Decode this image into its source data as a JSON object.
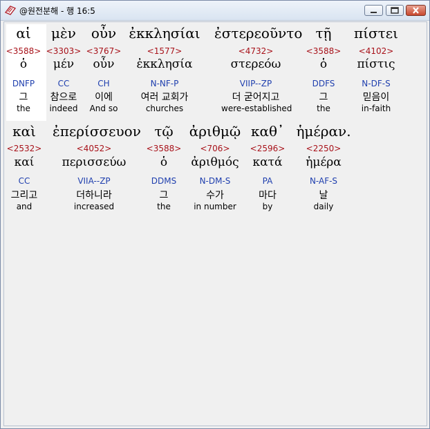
{
  "window": {
    "title": "@원전분해 - 행 16:5",
    "app_icon": "bible-book-icon",
    "buttons": [
      "minimize",
      "maximize",
      "close"
    ]
  },
  "verse": {
    "row1": [
      {
        "greek": "αἱ",
        "strong": "<3588>",
        "lemma": "ὁ",
        "parse": "DNFP",
        "korean": "그",
        "english": "the"
      },
      {
        "greek": "μὲν",
        "strong": "<3303>",
        "lemma": "μέν",
        "parse": "CC",
        "korean": "참으로",
        "english": "indeed"
      },
      {
        "greek": "οὖν",
        "strong": "<3767>",
        "lemma": "οὖν",
        "parse": "CH",
        "korean": "이에",
        "english": "And so"
      },
      {
        "greek": "ἐκκλησίαι",
        "strong": "<1577>",
        "lemma": "ἐκκλησία",
        "parse": "N-NF-P",
        "korean": "여러 교회가",
        "english": "churches"
      },
      {
        "greek": "ἐστερεοῦντο",
        "strong": "<4732>",
        "lemma": "στερεόω",
        "parse": "VIIP--ZP",
        "korean": "더 굳어지고",
        "english": "were-established"
      },
      {
        "greek": "τῇ",
        "strong": "<3588>",
        "lemma": "ὁ",
        "parse": "DDFS",
        "korean": "그",
        "english": "the"
      },
      {
        "greek": "πίστει",
        "strong": "<4102>",
        "lemma": "πίστις",
        "parse": "N-DF-S",
        "korean": "믿음이",
        "english": "in-faith"
      }
    ],
    "row2": [
      {
        "greek": "καὶ",
        "strong": "<2532>",
        "lemma": "καί",
        "parse": "CC",
        "korean": "그리고",
        "english": "and"
      },
      {
        "greek": "ἐπερίσσευον",
        "strong": "<4052>",
        "lemma": "περισσεύω",
        "parse": "VIIA--ZP",
        "korean": "더하니라",
        "english": "increased"
      },
      {
        "greek": "τῷ",
        "strong": "<3588>",
        "lemma": "ὁ",
        "parse": "DDMS",
        "korean": "그",
        "english": "the"
      },
      {
        "greek": "ἀριθμῷ",
        "strong": "<706>",
        "lemma": "ἀριθμός",
        "parse": "N-DM-S",
        "korean": "수가",
        "english": "in number"
      },
      {
        "greek": "καθ᾽",
        "strong": "<2596>",
        "lemma": "κατά",
        "parse": "PA",
        "korean": "마다",
        "english": "by"
      },
      {
        "greek": "ἡμέραν.",
        "strong": "<2250>",
        "lemma": "ἡμέρα",
        "parse": "N-AF-S",
        "korean": "날",
        "english": "daily"
      }
    ]
  }
}
